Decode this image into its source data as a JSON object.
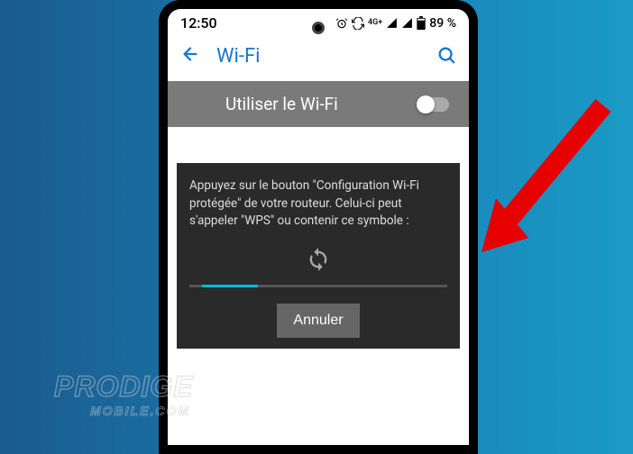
{
  "status_bar": {
    "time": "12:50",
    "network_label": "4G+",
    "battery_text": "89 %"
  },
  "app_bar": {
    "title": "Wi-Fi"
  },
  "toggle": {
    "label": "Utiliser le Wi-Fi"
  },
  "dialog": {
    "message": "Appuyez sur le bouton \"Configuration Wi-Fi protégée\" de votre routeur. Celui-ci peut s'appeler \"WPS\" ou contenir ce symbole :",
    "cancel_label": "Annuler"
  },
  "watermark": {
    "line1": "PRODIGE",
    "line2": "MOBILE.COM"
  }
}
